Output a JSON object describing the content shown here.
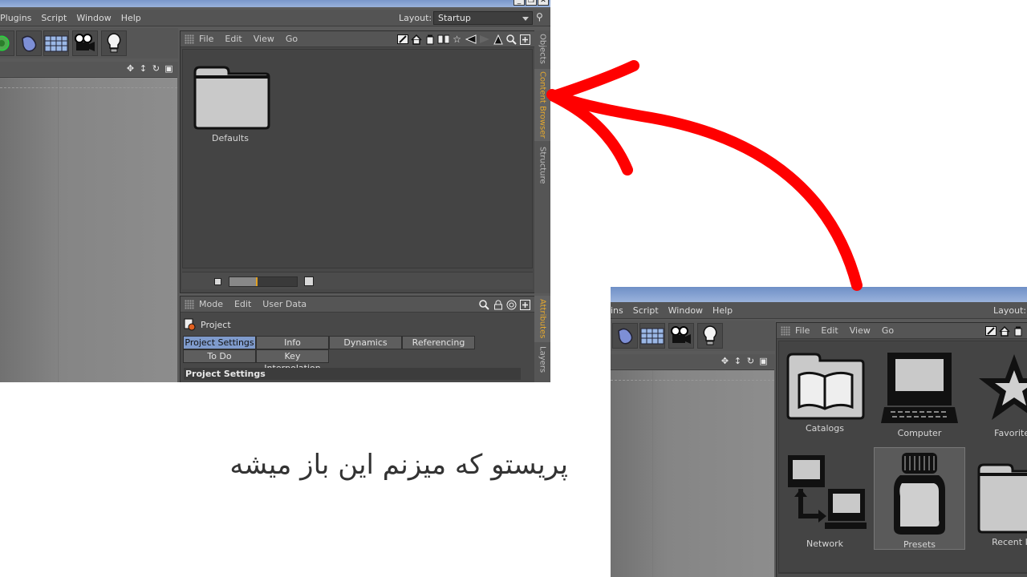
{
  "left_shot": {
    "menu": [
      "Plugins",
      "Script",
      "Window",
      "Help"
    ],
    "layout_label": "Layout:",
    "layout_value": "Startup",
    "panel_menu": [
      "File",
      "Edit",
      "View",
      "Go"
    ],
    "folder_item": "Defaults",
    "side_tabs_top": [
      "Objects",
      "Content Browser",
      "Structure"
    ],
    "side_tabs_bottom": [
      "Attributes",
      "Layers"
    ],
    "attr_menu": [
      "Mode",
      "Edit",
      "User Data"
    ],
    "project_label": "Project",
    "tabs": [
      "Project Settings",
      "Info",
      "Dynamics",
      "Referencing",
      "To Do",
      "Key Interpolation"
    ],
    "active_tab": "Project Settings",
    "group_header": "Project Settings"
  },
  "right_shot": {
    "menu": [
      "ins",
      "Script",
      "Window",
      "Help"
    ],
    "layout_label": "Layout:",
    "panel_menu": [
      "File",
      "Edit",
      "View",
      "Go"
    ],
    "items": [
      "Catalogs",
      "Computer",
      "Favorites",
      "Network",
      "Presets",
      "Recent Ite"
    ],
    "selected_item": "Presets"
  },
  "caption": "پریستو که میزنم این باز میشه",
  "annotation_color": "#ff0000",
  "accent_color": "#e6a92e"
}
